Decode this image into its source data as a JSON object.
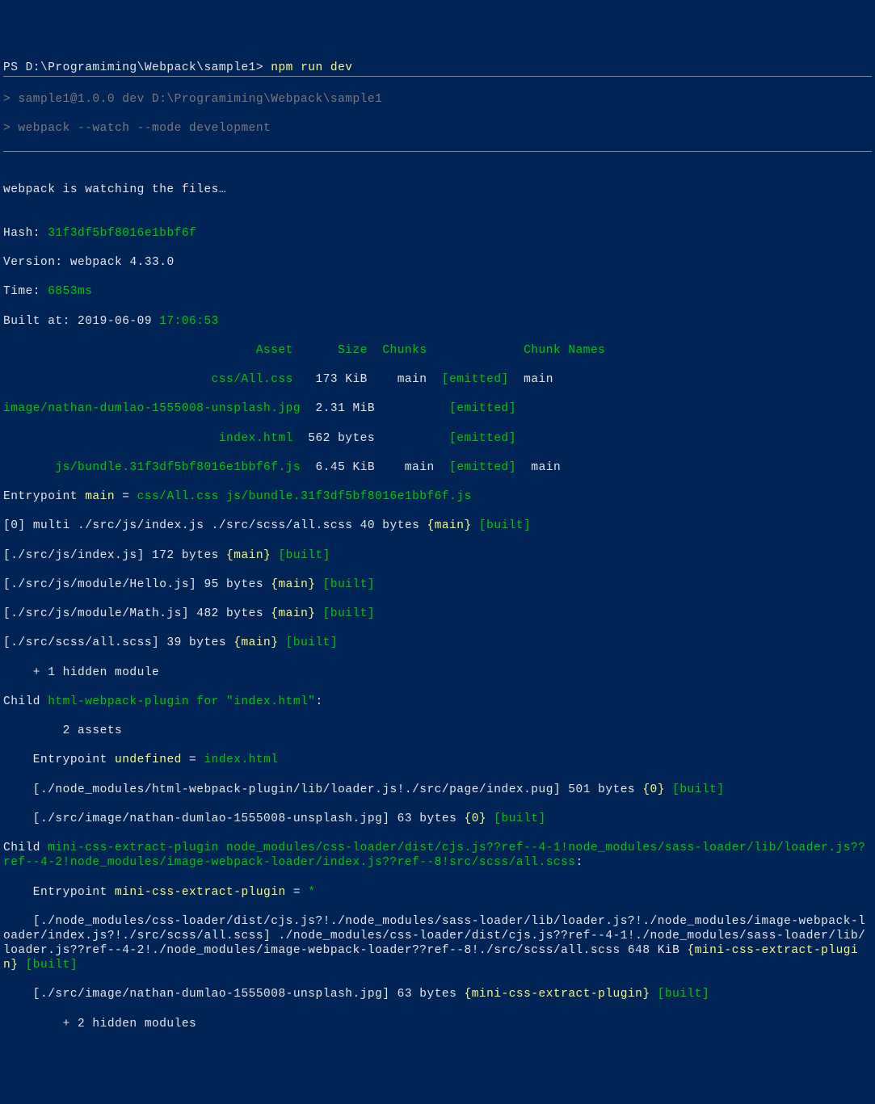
{
  "prompt": {
    "prefix": "PS ",
    "path": "D:\\Programiming\\Webpack\\sample1>",
    "command": "npm run dev"
  },
  "script_lines": [
    "> sample1@1.0.0 dev D:\\Programiming\\Webpack\\sample1",
    "> webpack --watch --mode development"
  ],
  "watch_msg": "webpack is watching the files…",
  "hash": {
    "label": "Hash: ",
    "value": "31f3df5bf8016e1bbf6f"
  },
  "version": {
    "label": "Version: ",
    "value": "webpack 4.33.0"
  },
  "time": {
    "label": "Time: ",
    "value": "6853ms"
  },
  "built_at": {
    "label": "Built at: ",
    "date": "2019-06-09 ",
    "time": "17:06:53"
  },
  "table_header": {
    "asset": "Asset",
    "size": "Size",
    "chunks": "Chunks",
    "chunk_names": "Chunk Names"
  },
  "assets": [
    {
      "name": "css/All.css",
      "size": "173 KiB",
      "chunk": "main",
      "status": "[emitted]",
      "chunk_name": "main"
    },
    {
      "name": "image/nathan-dumlao-1555008-unsplash.jpg",
      "size": "2.31 MiB",
      "chunk": "",
      "status": "[emitted]",
      "chunk_name": ""
    },
    {
      "name": "index.html",
      "size": "562 bytes",
      "chunk": "",
      "status": "[emitted]",
      "chunk_name": ""
    },
    {
      "name": "js/bundle.31f3df5bf8016e1bbf6f.js",
      "size": "6.45 KiB",
      "chunk": "main",
      "status": "[emitted]",
      "chunk_name": "main"
    }
  ],
  "entrypoint_main": {
    "label": "Entrypoint ",
    "name": "main",
    "eq": " = ",
    "files": "css/All.css js/bundle.31f3df5bf8016e1bbf6f.js"
  },
  "modules": [
    {
      "idx": "[0] ",
      "path": "multi ./src/js/index.js ./src/scss/all.scss",
      "size": " 40 bytes ",
      "chunk": "{main}",
      "status": " [built]"
    },
    {
      "idx": "",
      "path": "[./src/js/index.js]",
      "size": " 172 bytes ",
      "chunk": "{main}",
      "status": " [built]"
    },
    {
      "idx": "",
      "path": "[./src/js/module/Hello.js]",
      "size": " 95 bytes ",
      "chunk": "{main}",
      "status": " [built]"
    },
    {
      "idx": "",
      "path": "[./src/js/module/Math.js]",
      "size": " 482 bytes ",
      "chunk": "{main}",
      "status": " [built]"
    },
    {
      "idx": "",
      "path": "[./src/scss/all.scss]",
      "size": " 39 bytes ",
      "chunk": "{main}",
      "status": " [built]"
    }
  ],
  "hidden1": "    + 1 hidden module",
  "child1": {
    "prefix": "Child ",
    "name": "html-webpack-plugin for \"index.html\"",
    "suffix": ":"
  },
  "child1_assets": "        2 assets",
  "child1_entry": {
    "label": "    Entrypoint ",
    "name": "undefined",
    "eq": " = ",
    "file": "index.html"
  },
  "child1_mods": [
    {
      "path": "    [./node_modules/html-webpack-plugin/lib/loader.js!./src/page/index.pug]",
      "size": " 501 bytes ",
      "chunk": "{0}",
      "status": " [built]"
    },
    {
      "path": "    [./src/image/nathan-dumlao-1555008-unsplash.jpg]",
      "size": " 63 bytes ",
      "chunk": "{0}",
      "status": " [built]"
    }
  ],
  "child2": {
    "prefix": "Child ",
    "name": "mini-css-extract-plugin node_modules/css-loader/dist/cjs.js??ref--4-1!node_modules/sass-loader/lib/loader.js??ref--4-2!node_modules/image-webpack-loader/index.js??ref--8!src/scss/all.scss",
    "suffix": ":"
  },
  "child2_entry": {
    "label": "    Entrypoint ",
    "name": "mini-css-extract-plugin",
    "eq": " = ",
    "file": "*"
  },
  "child2_mod1": {
    "path": "    [./node_modules/css-loader/dist/cjs.js?!./node_modules/sass-loader/lib/loader.js?!./node_modules/image-webpack-loader/index.js?!./src/scss/all.scss]",
    "mid": " ./node_modules/css-loader/dist/cjs.js??ref--4-1!./node_modules/sass-loader/lib/loader.js??ref--4-2!./node_modules/image-webpack-loader??ref--8!./src/scss/all.scss",
    "size": " 648 KiB ",
    "chunk": "{mini-css-extract-plugin}",
    "status": " [built]"
  },
  "child2_mod2": {
    "path": "    [./src/image/nathan-dumlao-1555008-unsplash.jpg]",
    "size": " 63 bytes ",
    "chunk": "{mini-css-extract-plugin}",
    "status": " [built]"
  },
  "hidden2": "        + 2 hidden modules"
}
